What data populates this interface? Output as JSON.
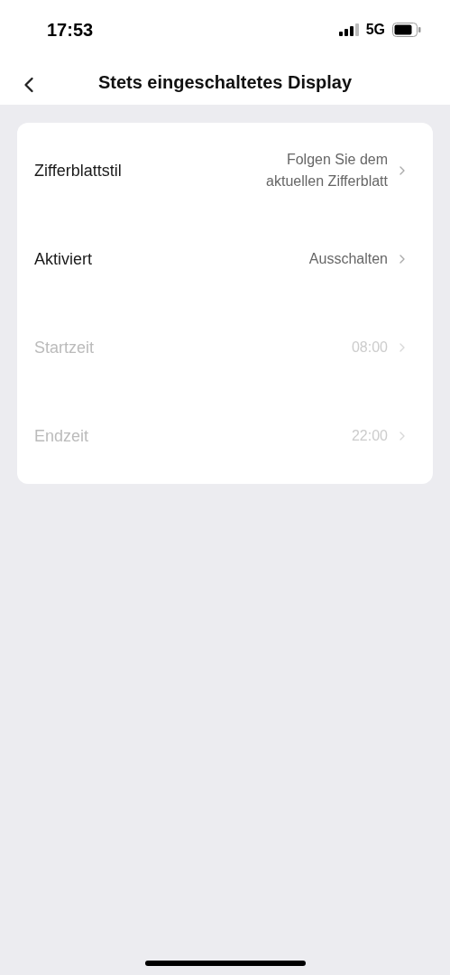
{
  "status_bar": {
    "time": "17:53",
    "network": "5G"
  },
  "header": {
    "title": "Stets eingeschaltetes Display"
  },
  "settings": [
    {
      "label": "Zifferblattstil",
      "value": "Folgen Sie dem aktuellen Zifferblatt",
      "disabled": false
    },
    {
      "label": "Aktiviert",
      "value": "Ausschalten",
      "disabled": false
    },
    {
      "label": "Startzeit",
      "value": "08:00",
      "disabled": true
    },
    {
      "label": "Endzeit",
      "value": "22:00",
      "disabled": true
    }
  ]
}
